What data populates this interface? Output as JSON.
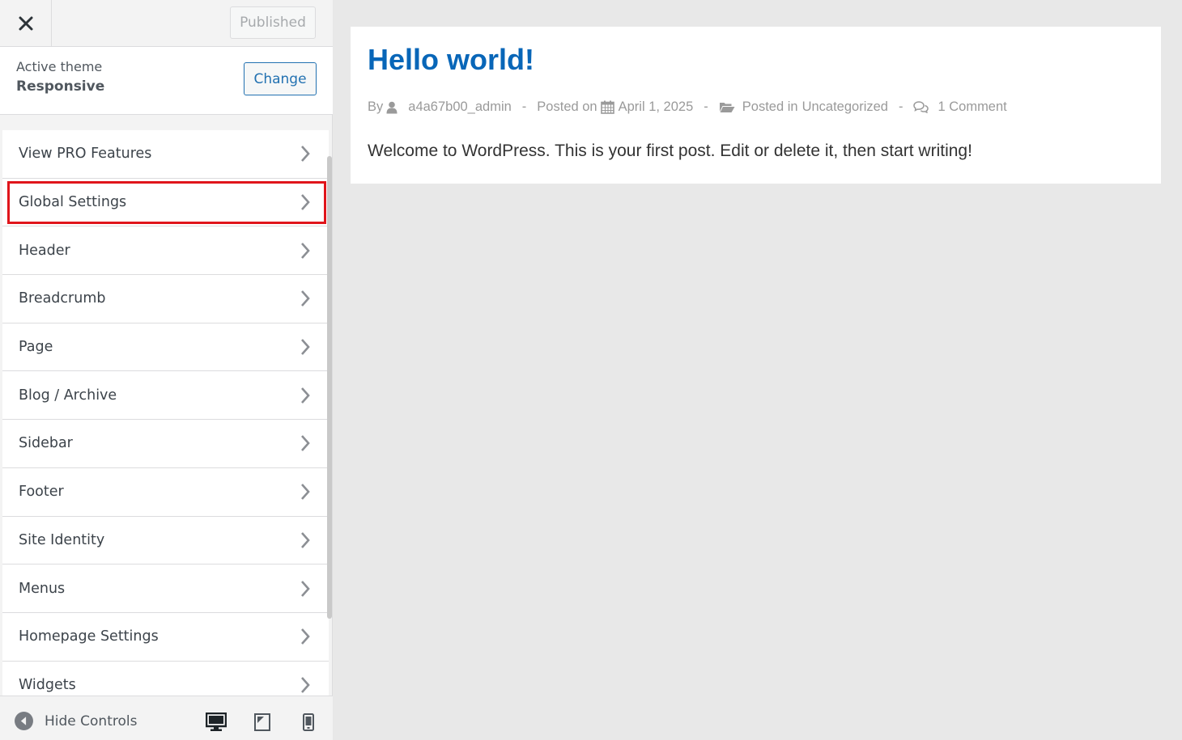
{
  "topbar": {
    "close_icon": "close-icon",
    "publish_label": "Published"
  },
  "theme": {
    "label": "Active theme",
    "name": "Responsive",
    "change_label": "Change"
  },
  "panels": [
    {
      "label": "View PRO Features"
    },
    {
      "label": "Global Settings",
      "highlighted": true
    },
    {
      "label": "Header"
    },
    {
      "label": "Breadcrumb"
    },
    {
      "label": "Page"
    },
    {
      "label": "Blog / Archive"
    },
    {
      "label": "Sidebar"
    },
    {
      "label": "Footer"
    },
    {
      "label": "Site Identity"
    },
    {
      "label": "Menus"
    },
    {
      "label": "Homepage Settings"
    },
    {
      "label": "Widgets"
    }
  ],
  "footer": {
    "hide_label": "Hide Controls",
    "devices": [
      "desktop-icon",
      "tablet-icon",
      "mobile-icon"
    ]
  },
  "post": {
    "title": "Hello world!",
    "meta": {
      "by": "By",
      "author": "a4a67b00_admin",
      "posted_on": "Posted on",
      "date": "April 1, 2025",
      "posted_in": "Posted in",
      "category": "Uncategorized",
      "comments": "1 Comment",
      "separator": "-"
    },
    "body": "Welcome to WordPress. This is your first post. Edit or delete it, then start writing!"
  },
  "colors": {
    "accent": "#2271b1",
    "title_link": "#0866b8",
    "highlight": "#e0151b"
  }
}
